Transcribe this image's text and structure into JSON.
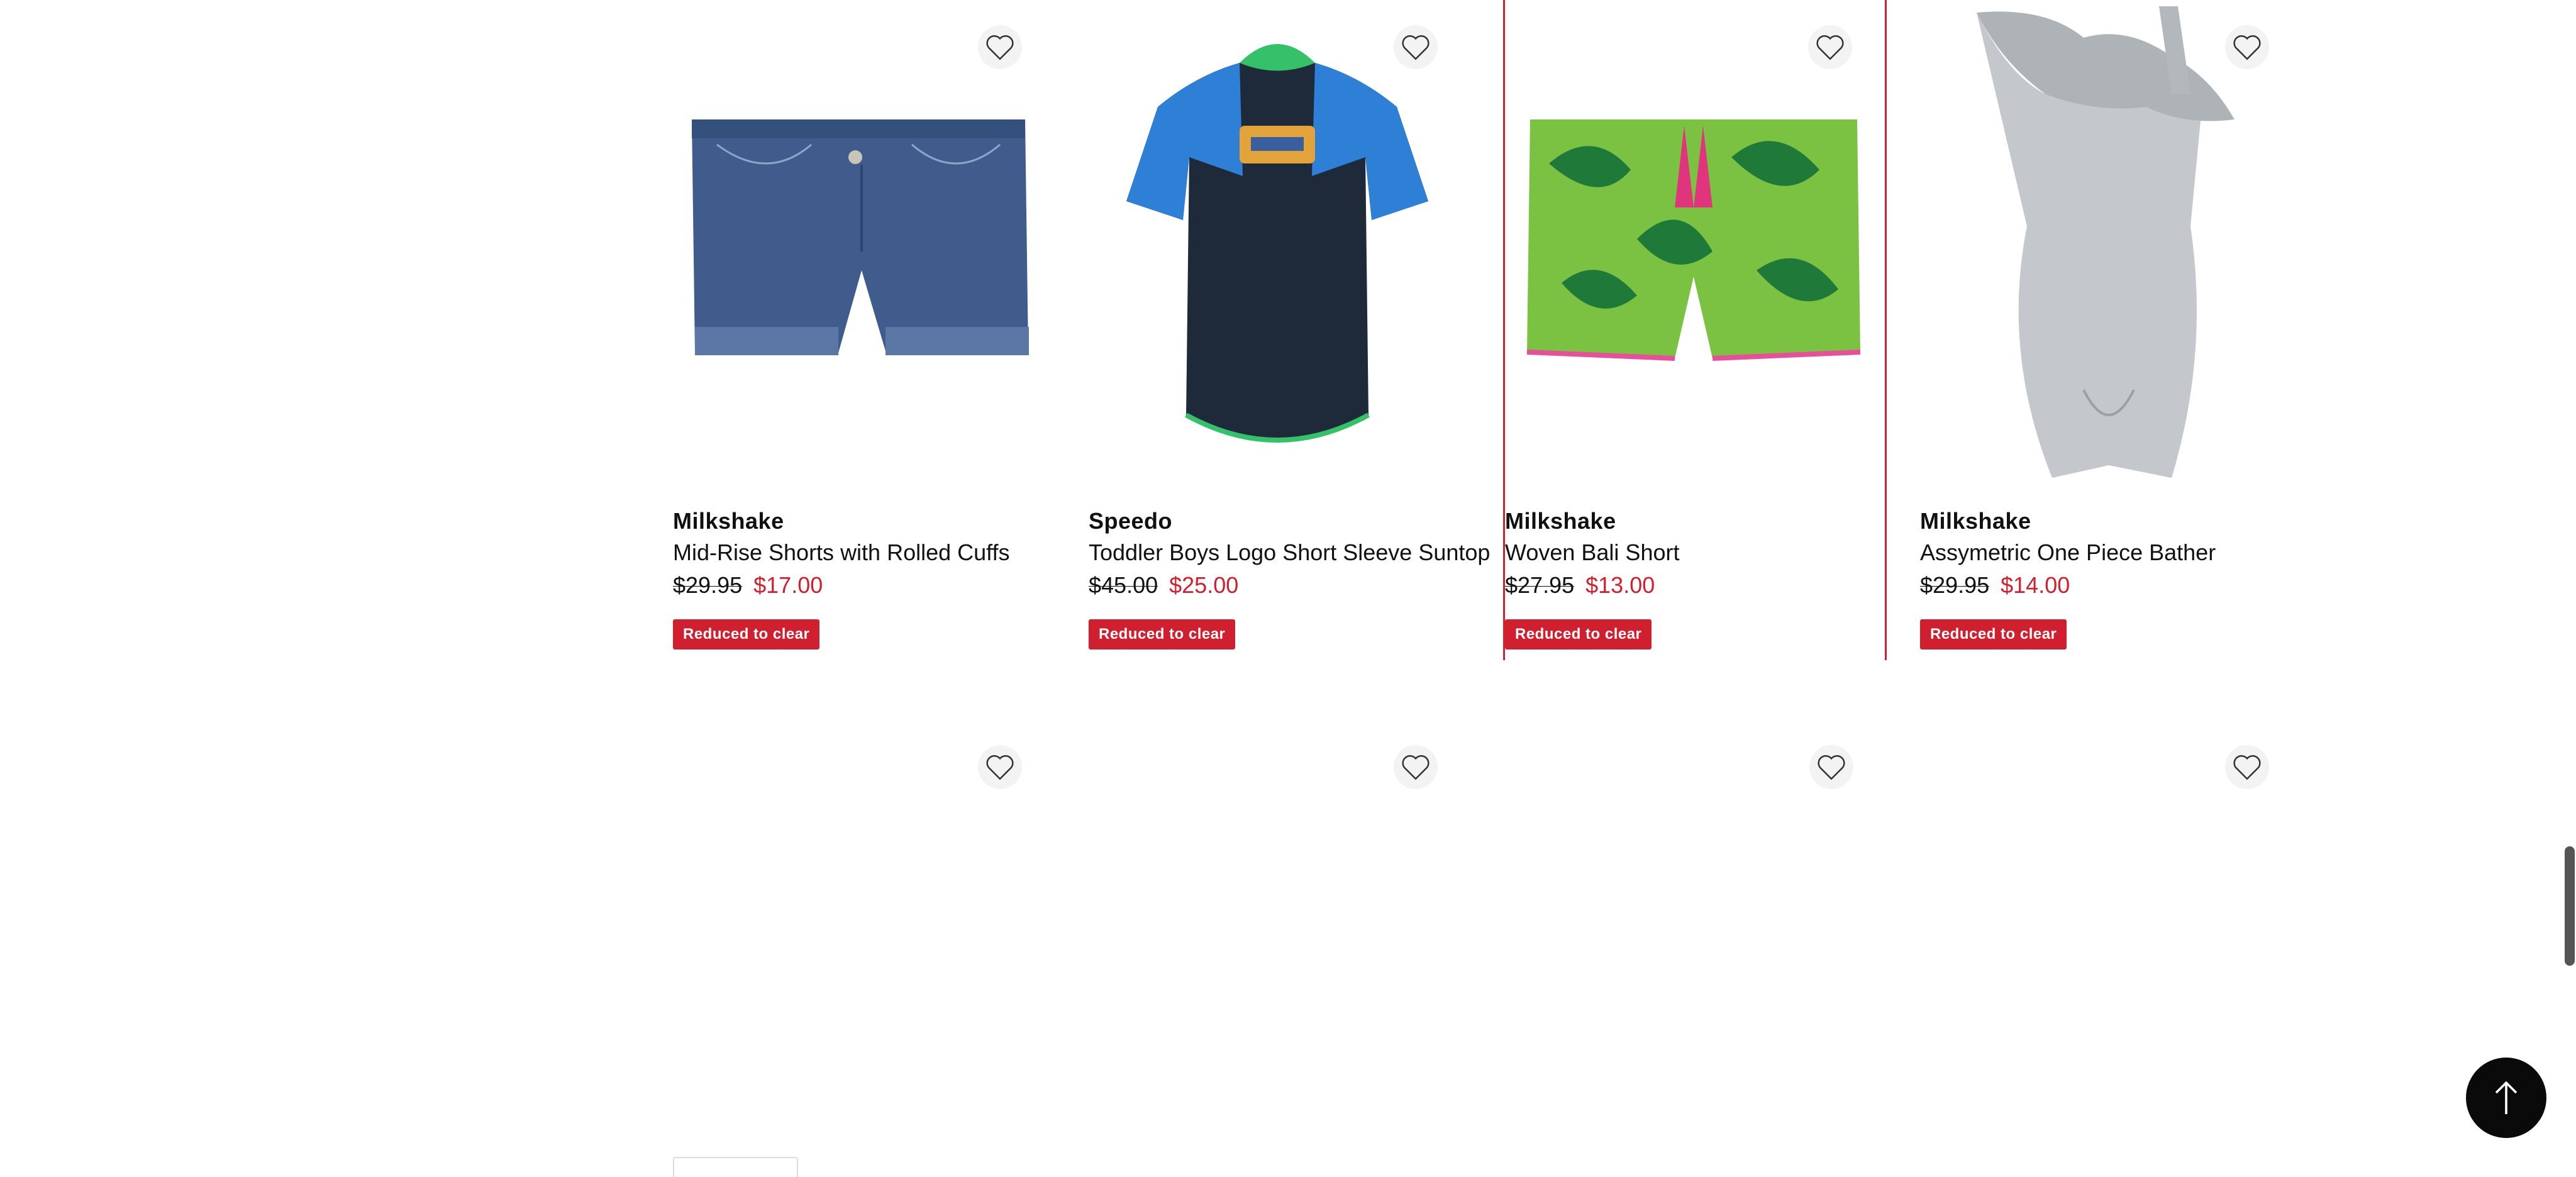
{
  "colors": {
    "sale_red": "#d0202f",
    "text": "#111111",
    "back_to_top_bg": "#0a0a0a"
  },
  "products": [
    {
      "brand": "Milkshake",
      "title": "Mid-Rise Shorts with Rolled Cuffs",
      "price_old": "$29.95",
      "price_new": "$17.00",
      "badge": "Reduced to clear",
      "image": "denim-shorts"
    },
    {
      "brand": "Speedo",
      "title": "Toddler Boys Logo Short Sleeve Suntop",
      "price_old": "$45.00",
      "price_new": "$25.00",
      "badge": "Reduced to clear",
      "image": "rash-top"
    },
    {
      "brand": "Milkshake",
      "title": "Woven Bali Short",
      "price_old": "$27.95",
      "price_new": "$13.00",
      "badge": "Reduced to clear",
      "image": "leaf-print-shorts"
    },
    {
      "brand": "Milkshake",
      "title": "Assymetric One Piece Bather",
      "price_old": "$29.95",
      "price_new": "$14.00",
      "badge": "Reduced to clear",
      "image": "silver-swimsuit"
    }
  ],
  "icons": {
    "wishlist": "heart-icon",
    "back_to_top": "arrow-up-icon"
  }
}
